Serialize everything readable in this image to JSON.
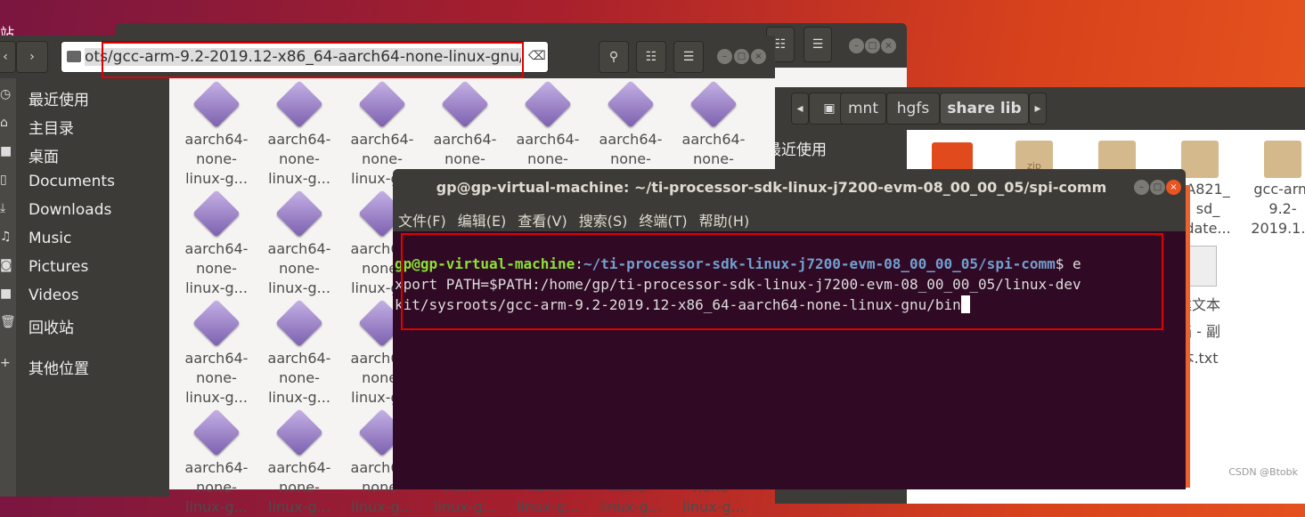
{
  "desktop": {
    "trash_label_partial": "站"
  },
  "back_window": {
    "menu_icon": "hamburger-icon",
    "view_icon": "list-view-icon"
  },
  "share_window": {
    "path": [
      "mnt",
      "hgfs",
      "share lib"
    ],
    "sidebar_partial": "最近使用",
    "files": [
      {
        "lines": [
          ""
        ],
        "icon": "folder-red"
      },
      {
        "lines": [
          ""
        ],
        "icon": "zip-archive"
      },
      {
        "lines": [
          ""
        ],
        "icon": "archive"
      },
      {
        "lines": [
          "A821_",
          "sd_",
          "date..."
        ],
        "icon": "archive"
      },
      {
        "lines": [
          "gcc-arm",
          "9.2-",
          "2019.1..."
        ],
        "icon": "archive"
      },
      {
        "lines": [
          "建文本",
          "档 - 副",
          "本.txt"
        ],
        "icon": "text-file"
      }
    ],
    "zip_label": "zip"
  },
  "file_manager": {
    "address": "ots/gcc-arm-9.2-2019.12-x86_64-aarch64-none-linux-gnu/bin",
    "sidebar": [
      {
        "label": "最近使用",
        "icon": "clock-icon"
      },
      {
        "label": "主目录",
        "icon": "home-icon"
      },
      {
        "label": "桌面",
        "icon": "desktop-icon"
      },
      {
        "label": "Documents",
        "icon": "document-icon"
      },
      {
        "label": "Downloads",
        "icon": "download-icon"
      },
      {
        "label": "Music",
        "icon": "music-icon"
      },
      {
        "label": "Pictures",
        "icon": "camera-icon"
      },
      {
        "label": "Videos",
        "icon": "video-icon"
      },
      {
        "label": "回收站",
        "icon": "trash-icon"
      },
      {
        "label": "其他位置",
        "icon": "plus-icon"
      }
    ],
    "file_label": [
      "aarch64-",
      "none-",
      "linux-g..."
    ],
    "file_count": 28
  },
  "terminal": {
    "title": "gp@gp-virtual-machine: ~/ti-processor-sdk-linux-j7200-evm-08_00_00_05/spi-comm",
    "menu": [
      "文件(F)",
      "编辑(E)",
      "查看(V)",
      "搜索(S)",
      "终端(T)",
      "帮助(H)"
    ],
    "prompt_user": "gp@gp-virtual-machine",
    "prompt_path": "~/ti-processor-sdk-linux-j7200-evm-08_00_00_05/spi-comm",
    "prompt_sign": "$ e",
    "line2": "xport PATH=$PATH:/home/gp/ti-processor-sdk-linux-j7200-evm-08_00_00_05/linux-dev",
    "line3": "kit/sysroots/gcc-arm-9.2-2019.12-x86_64-aarch64-none-linux-gnu/bin"
  },
  "colors": {
    "highlight_box": "#e00000",
    "terminal_bg": "#300a24",
    "prompt_user": "#8ae234",
    "prompt_path": "#729fcf"
  },
  "watermark": "CSDN @Btobk"
}
